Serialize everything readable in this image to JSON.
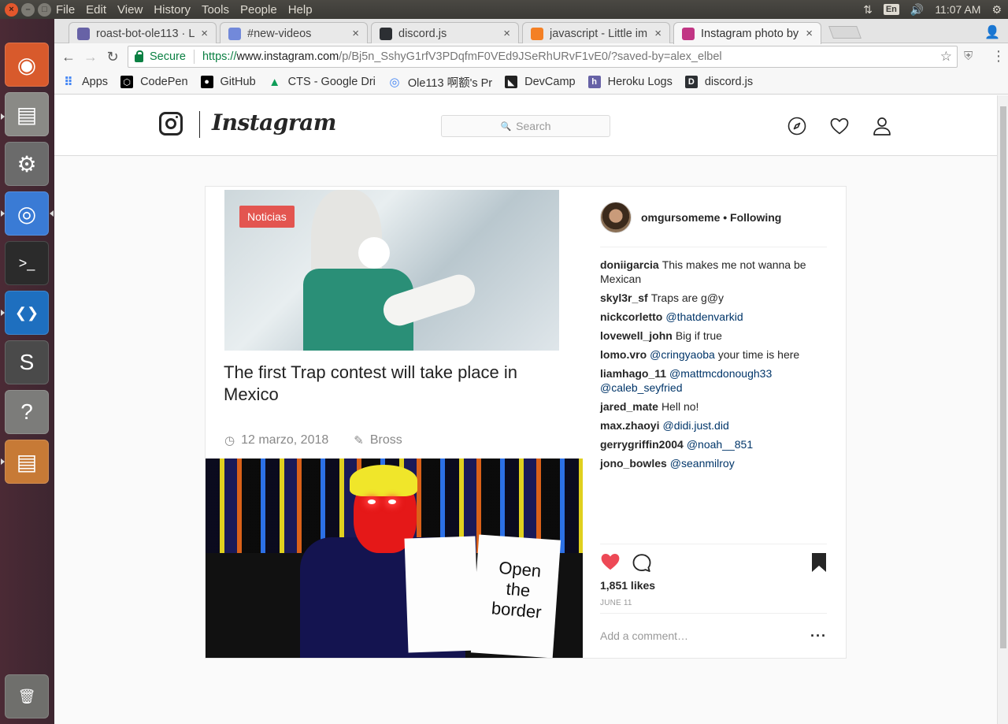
{
  "system": {
    "menus": [
      "File",
      "Edit",
      "View",
      "History",
      "Tools",
      "People",
      "Help"
    ],
    "keyboard": "En",
    "time": "11:07 AM"
  },
  "launcher": [
    "ubuntu-dash-icon",
    "files-icon",
    "system-settings-icon",
    "chrome-icon",
    "terminal-icon",
    "vscode-icon",
    "sublime-text-icon",
    "software-updater-icon",
    "files-icon-2",
    "trash-icon"
  ],
  "tabs": [
    {
      "title": "roast-bot-ole113 · L",
      "favicon": "heroku-icon",
      "color": "#6762a6"
    },
    {
      "title": "#new-videos",
      "favicon": "discord-notify-icon",
      "color": "#7289da"
    },
    {
      "title": "discord.js",
      "favicon": "discordjs-icon",
      "color": "#2c2f33"
    },
    {
      "title": "javascript - Little im",
      "favicon": "stackoverflow-icon",
      "color": "#f48024"
    },
    {
      "title": "Instagram photo by",
      "favicon": "instagram-icon",
      "color": "#c13584"
    }
  ],
  "omnibox": {
    "secure_label": "Secure",
    "scheme": "https://",
    "host": "www.instagram.com",
    "path": "/p/Bj5n_SshyG1rfV3PDqfmF0VEd9JSeRhURvF1vE0/?saved-by=alex_elbel"
  },
  "bookmarks": [
    {
      "label": "Apps",
      "icon": "apps-grid-icon",
      "color": "#4285f4"
    },
    {
      "label": "CodePen",
      "icon": "codepen-icon",
      "color": "#000000"
    },
    {
      "label": "GitHub",
      "icon": "github-icon",
      "color": "#000000"
    },
    {
      "label": "CTS - Google Dri",
      "icon": "google-drive-icon",
      "color": "#0f9d58"
    },
    {
      "label": "Ole113 啊额's Pr",
      "icon": "chrome-ext-icon",
      "color": "#4285f4"
    },
    {
      "label": "DevCamp",
      "icon": "devcamp-icon",
      "color": "#222222"
    },
    {
      "label": "Heroku Logs",
      "icon": "heroku-icon",
      "color": "#6762a6"
    },
    {
      "label": "discord.js",
      "icon": "discordjs-icon",
      "color": "#2c2f33"
    }
  ],
  "instagram": {
    "wordmark": "Instagram",
    "search_placeholder": "Search",
    "post": {
      "author": "omgursomeme • Following",
      "media": {
        "badge": "Noticias",
        "headline": "The first Trap contest will take place in Mexico",
        "date": "12 marzo, 2018",
        "byline": "Bross",
        "sign_text": "Open the border"
      },
      "comments": [
        {
          "user": "doniigarcia",
          "text": "This makes me not wanna be Mexican",
          "mention": ""
        },
        {
          "user": "skyl3r_sf",
          "text": "Traps are g@y",
          "mention": ""
        },
        {
          "user": "nickcorletto",
          "text": "",
          "mention": "@thatdenvarkid"
        },
        {
          "user": "lovewell_john",
          "text": "Big if true",
          "mention": ""
        },
        {
          "user": "lomo.vro",
          "text": " your time is here",
          "mention": "@cringyaoba"
        },
        {
          "user": "liamhago_11",
          "text": "",
          "mention": "@mattmcdonough33 @caleb_seyfried"
        },
        {
          "user": "jared_mate",
          "text": "Hell no!",
          "mention": ""
        },
        {
          "user": "max.zhaoyi",
          "text": "",
          "mention": "@didi.just.did"
        },
        {
          "user": "gerrygriffin2004",
          "text": "",
          "mention": "@noah__851"
        },
        {
          "user": "jono_bowles",
          "text": "",
          "mention": "@seanmilroy"
        }
      ],
      "likes": "1,851 likes",
      "date": "JUNE 11",
      "add_comment_placeholder": "Add a comment…",
      "liked": true,
      "like_color": "#ed4956"
    }
  }
}
